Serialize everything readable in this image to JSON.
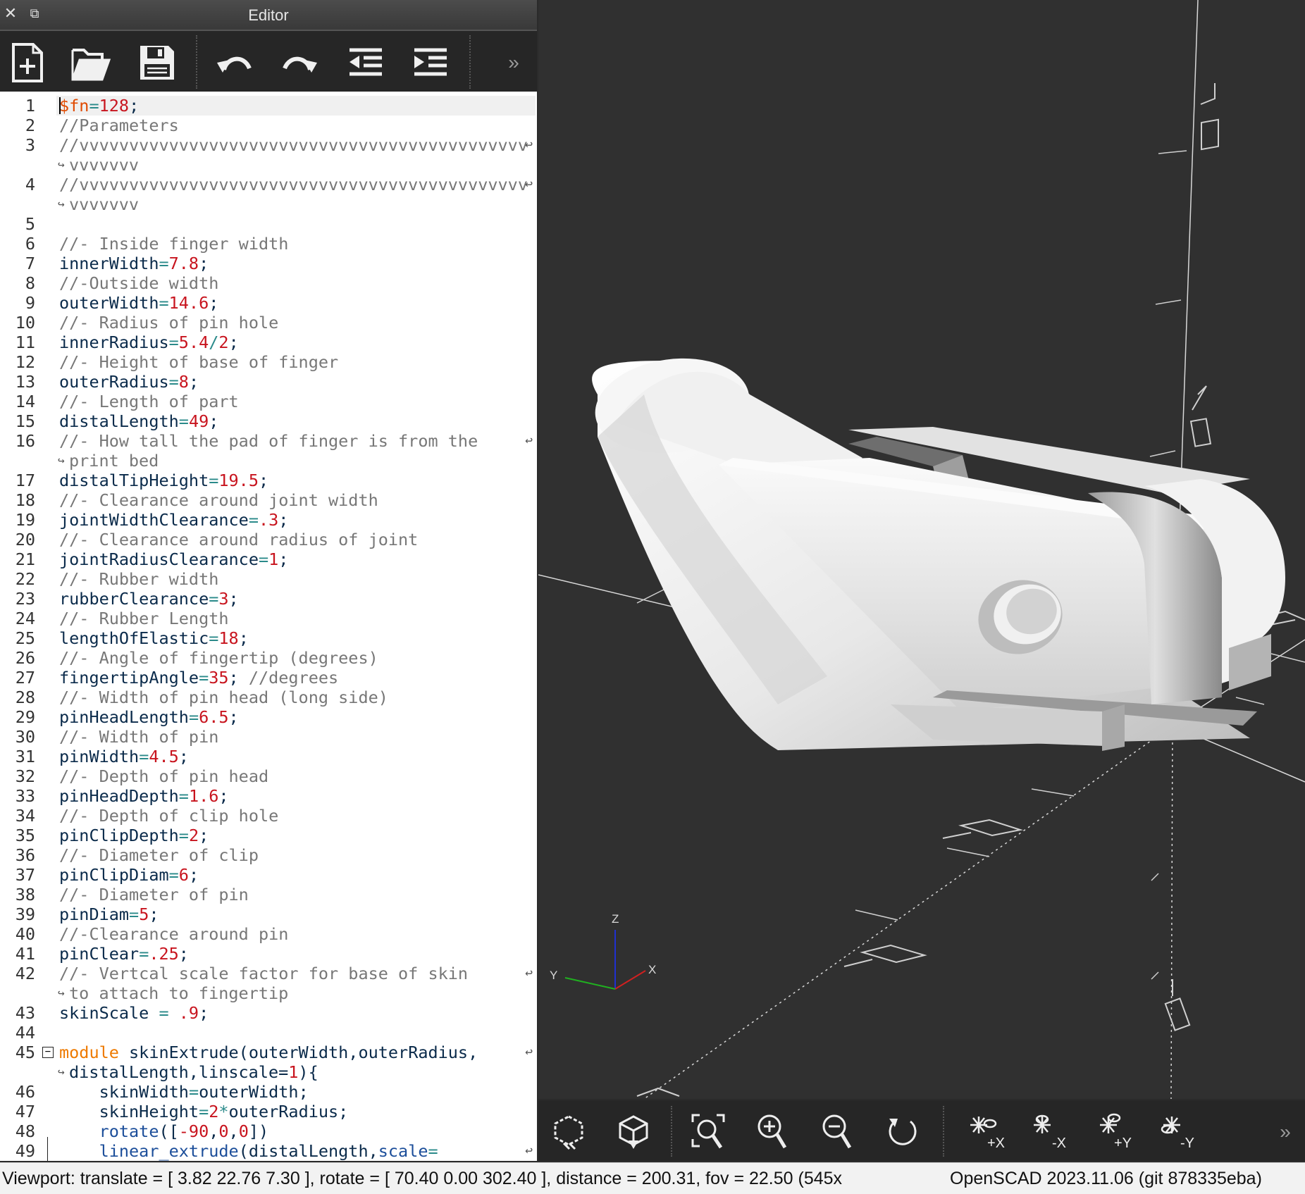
{
  "window": {
    "title": "Editor"
  },
  "editor_toolbar": {
    "icons": [
      "new-file-icon",
      "open-file-icon",
      "save-icon",
      "undo-icon",
      "redo-icon",
      "unindent-icon",
      "indent-icon",
      "more-icon"
    ]
  },
  "code_lines": [
    {
      "n": "1",
      "segs": [
        [
          "$fn",
          "spec"
        ],
        [
          "=",
          "op"
        ],
        [
          "128",
          "num"
        ],
        [
          ";",
          "id"
        ]
      ]
    },
    {
      "n": "2",
      "segs": [
        [
          "//Parameters",
          "cmt"
        ]
      ]
    },
    {
      "n": "3",
      "wrap": true,
      "segs": [
        [
          "//vvvvvvvvvvvvvvvvvvvvvvvvvvvvvvvvvvvvvvvvvvvvv",
          "cmt"
        ]
      ],
      "cont": [
        [
          "vvvvvvv",
          "cmt"
        ]
      ]
    },
    {
      "n": "4",
      "wrap": true,
      "segs": [
        [
          "//vvvvvvvvvvvvvvvvvvvvvvvvvvvvvvvvvvvvvvvvvvvvv",
          "cmt"
        ]
      ],
      "cont": [
        [
          "vvvvvvv",
          "cmt"
        ]
      ]
    },
    {
      "n": "5",
      "segs": []
    },
    {
      "n": "6",
      "segs": [
        [
          "//- Inside finger width",
          "cmt"
        ]
      ]
    },
    {
      "n": "7",
      "segs": [
        [
          "innerWidth",
          "id"
        ],
        [
          "=",
          "op"
        ],
        [
          "7.8",
          "num"
        ],
        [
          ";",
          "id"
        ]
      ]
    },
    {
      "n": "8",
      "segs": [
        [
          "//-Outside width",
          "cmt"
        ]
      ]
    },
    {
      "n": "9",
      "segs": [
        [
          "outerWidth",
          "id"
        ],
        [
          "=",
          "op"
        ],
        [
          "14.6",
          "num"
        ],
        [
          ";",
          "id"
        ]
      ]
    },
    {
      "n": "10",
      "segs": [
        [
          "//- Radius of pin hole",
          "cmt"
        ]
      ]
    },
    {
      "n": "11",
      "segs": [
        [
          "innerRadius",
          "id"
        ],
        [
          "=",
          "op"
        ],
        [
          "5.4",
          "num"
        ],
        [
          "/",
          "op"
        ],
        [
          "2",
          "num"
        ],
        [
          ";",
          "id"
        ]
      ]
    },
    {
      "n": "12",
      "segs": [
        [
          "//- Height of base of finger",
          "cmt"
        ]
      ]
    },
    {
      "n": "13",
      "segs": [
        [
          "outerRadius",
          "id"
        ],
        [
          "=",
          "op"
        ],
        [
          "8",
          "num"
        ],
        [
          ";",
          "id"
        ]
      ]
    },
    {
      "n": "14",
      "segs": [
        [
          "//- Length of part",
          "cmt"
        ]
      ]
    },
    {
      "n": "15",
      "segs": [
        [
          "distalLength",
          "id"
        ],
        [
          "=",
          "op"
        ],
        [
          "49",
          "num"
        ],
        [
          ";",
          "id"
        ]
      ]
    },
    {
      "n": "16",
      "wrap": true,
      "segs": [
        [
          "//- How tall the pad of finger is from the",
          "cmt"
        ]
      ],
      "cont": [
        [
          "print bed",
          "cmt"
        ]
      ]
    },
    {
      "n": "17",
      "segs": [
        [
          "distalTipHeight",
          "id"
        ],
        [
          "=",
          "op"
        ],
        [
          "19.5",
          "num"
        ],
        [
          ";",
          "id"
        ]
      ]
    },
    {
      "n": "18",
      "segs": [
        [
          "//- Clearance around joint width",
          "cmt"
        ]
      ]
    },
    {
      "n": "19",
      "segs": [
        [
          "jointWidthClearance",
          "id"
        ],
        [
          "=",
          "op"
        ],
        [
          ".3",
          "num"
        ],
        [
          ";",
          "id"
        ]
      ]
    },
    {
      "n": "20",
      "segs": [
        [
          "//- Clearance around radius of joint",
          "cmt"
        ]
      ]
    },
    {
      "n": "21",
      "segs": [
        [
          "jointRadiusClearance",
          "id"
        ],
        [
          "=",
          "op"
        ],
        [
          "1",
          "num"
        ],
        [
          ";",
          "id"
        ]
      ]
    },
    {
      "n": "22",
      "segs": [
        [
          "//- Rubber width",
          "cmt"
        ]
      ]
    },
    {
      "n": "23",
      "segs": [
        [
          "rubberClearance",
          "id"
        ],
        [
          "=",
          "op"
        ],
        [
          "3",
          "num"
        ],
        [
          ";",
          "id"
        ]
      ]
    },
    {
      "n": "24",
      "segs": [
        [
          "//- Rubber Length",
          "cmt"
        ]
      ]
    },
    {
      "n": "25",
      "segs": [
        [
          "lengthOfElastic",
          "id"
        ],
        [
          "=",
          "op"
        ],
        [
          "18",
          "num"
        ],
        [
          ";",
          "id"
        ]
      ]
    },
    {
      "n": "26",
      "segs": [
        [
          "//- Angle of fingertip (degrees)",
          "cmt"
        ]
      ]
    },
    {
      "n": "27",
      "segs": [
        [
          "fingertipAngle",
          "id"
        ],
        [
          "=",
          "op"
        ],
        [
          "35",
          "num"
        ],
        [
          "; ",
          "id"
        ],
        [
          "//degrees",
          "cmt"
        ]
      ]
    },
    {
      "n": "28",
      "segs": [
        [
          "//- Width of pin head (long side)",
          "cmt"
        ]
      ]
    },
    {
      "n": "29",
      "segs": [
        [
          "pinHeadLength",
          "id"
        ],
        [
          "=",
          "op"
        ],
        [
          "6.5",
          "num"
        ],
        [
          ";",
          "id"
        ]
      ]
    },
    {
      "n": "30",
      "segs": [
        [
          "//- Width of pin",
          "cmt"
        ]
      ]
    },
    {
      "n": "31",
      "segs": [
        [
          "pinWidth",
          "id"
        ],
        [
          "=",
          "op"
        ],
        [
          "4.5",
          "num"
        ],
        [
          ";",
          "id"
        ]
      ]
    },
    {
      "n": "32",
      "segs": [
        [
          "//- Depth of pin head",
          "cmt"
        ]
      ]
    },
    {
      "n": "33",
      "segs": [
        [
          "pinHeadDepth",
          "id"
        ],
        [
          "=",
          "op"
        ],
        [
          "1.6",
          "num"
        ],
        [
          ";",
          "id"
        ]
      ]
    },
    {
      "n": "34",
      "segs": [
        [
          "//- Depth of clip hole",
          "cmt"
        ]
      ]
    },
    {
      "n": "35",
      "segs": [
        [
          "pinClipDepth",
          "id"
        ],
        [
          "=",
          "op"
        ],
        [
          "2",
          "num"
        ],
        [
          ";",
          "id"
        ]
      ]
    },
    {
      "n": "36",
      "segs": [
        [
          "//- Diameter of clip",
          "cmt"
        ]
      ]
    },
    {
      "n": "37",
      "segs": [
        [
          "pinClipDiam",
          "id"
        ],
        [
          "=",
          "op"
        ],
        [
          "6",
          "num"
        ],
        [
          ";",
          "id"
        ]
      ]
    },
    {
      "n": "38",
      "segs": [
        [
          "//- Diameter of pin",
          "cmt"
        ]
      ]
    },
    {
      "n": "39",
      "segs": [
        [
          "pinDiam",
          "id"
        ],
        [
          "=",
          "op"
        ],
        [
          "5",
          "num"
        ],
        [
          ";",
          "id"
        ]
      ]
    },
    {
      "n": "40",
      "segs": [
        [
          "//-Clearance around pin",
          "cmt"
        ]
      ]
    },
    {
      "n": "41",
      "segs": [
        [
          "pinClear",
          "id"
        ],
        [
          "=",
          "op"
        ],
        [
          ".25",
          "num"
        ],
        [
          ";",
          "id"
        ]
      ]
    },
    {
      "n": "42",
      "wrap": true,
      "segs": [
        [
          "//- Vertcal scale factor for base of skin",
          "cmt"
        ]
      ],
      "cont": [
        [
          "to attach to fingertip",
          "cmt"
        ]
      ]
    },
    {
      "n": "43",
      "segs": [
        [
          "skinScale ",
          "id"
        ],
        [
          "=",
          "op"
        ],
        [
          " .9",
          "num"
        ],
        [
          ";",
          "id"
        ]
      ]
    },
    {
      "n": "44",
      "segs": []
    },
    {
      "n": "45",
      "wrap": true,
      "fold": true,
      "segs": [
        [
          "module",
          "kw"
        ],
        [
          " skinExtrude(outerWidth,outerRadius,",
          "id"
        ]
      ],
      "cont": [
        [
          "distalLength,linscale=",
          "id"
        ],
        [
          "1",
          "num"
        ],
        [
          "){",
          "id"
        ]
      ]
    },
    {
      "n": "46",
      "segs": [
        [
          "    skinWidth",
          "id"
        ],
        [
          "=",
          "op"
        ],
        [
          "outerWidth;",
          "id"
        ]
      ]
    },
    {
      "n": "47",
      "segs": [
        [
          "    skinHeight",
          "id"
        ],
        [
          "=",
          "op"
        ],
        [
          "2",
          "num"
        ],
        [
          "*",
          "op"
        ],
        [
          "outerRadius;",
          "id"
        ]
      ]
    },
    {
      "n": "48",
      "segs": [
        [
          "    ",
          "id"
        ],
        [
          "rotate",
          "fn"
        ],
        [
          "([",
          "id"
        ],
        [
          "-90",
          "num"
        ],
        [
          ",",
          "id"
        ],
        [
          "0",
          "num"
        ],
        [
          ",",
          "id"
        ],
        [
          "0",
          "num"
        ],
        [
          "])",
          "id"
        ]
      ]
    },
    {
      "n": "49",
      "wrap": true,
      "segs": [
        [
          "    ",
          "id"
        ],
        [
          "linear_extrude",
          "fn"
        ],
        [
          "(distalLength,",
          "id"
        ],
        [
          "scale",
          "fn"
        ],
        [
          "=",
          "op"
        ]
      ]
    }
  ],
  "viewport": {
    "axis_labels": {
      "x": "X",
      "y": "Y",
      "z": "Z"
    },
    "scale_labels": [
      "10",
      "20",
      "40",
      "30",
      "10",
      "20",
      "30",
      "40",
      "20",
      "10"
    ]
  },
  "viewport_toolbar": {
    "buttons": [
      {
        "icon": "reset-view-icon"
      },
      {
        "icon": "view-all-icon"
      },
      {
        "icon": "zoom-all-icon"
      },
      {
        "icon": "zoom-in-icon"
      },
      {
        "icon": "zoom-out-icon"
      },
      {
        "icon": "reset-rotation-icon"
      },
      {
        "icon": "view-right-icon",
        "label": "+X"
      },
      {
        "icon": "view-left-icon",
        "label": "-X"
      },
      {
        "icon": "view-back-icon",
        "label": "+Y"
      },
      {
        "icon": "view-front-icon",
        "label": "-Y"
      },
      {
        "icon": "more-icon"
      }
    ]
  },
  "status": {
    "viewport_info": "Viewport: translate = [ 3.82 22.76 7.30 ], rotate = [ 70.40 0.00 302.40 ], distance = 200.31, fov = 22.50 (545x",
    "version": "OpenSCAD 2023.11.06 (git 878335eba)"
  },
  "colors": {
    "viewport_bg": "#303030",
    "model": "#e8e8e8",
    "axis_x": "#d02020",
    "axis_y": "#20b020",
    "axis_z": "#2030d0"
  }
}
